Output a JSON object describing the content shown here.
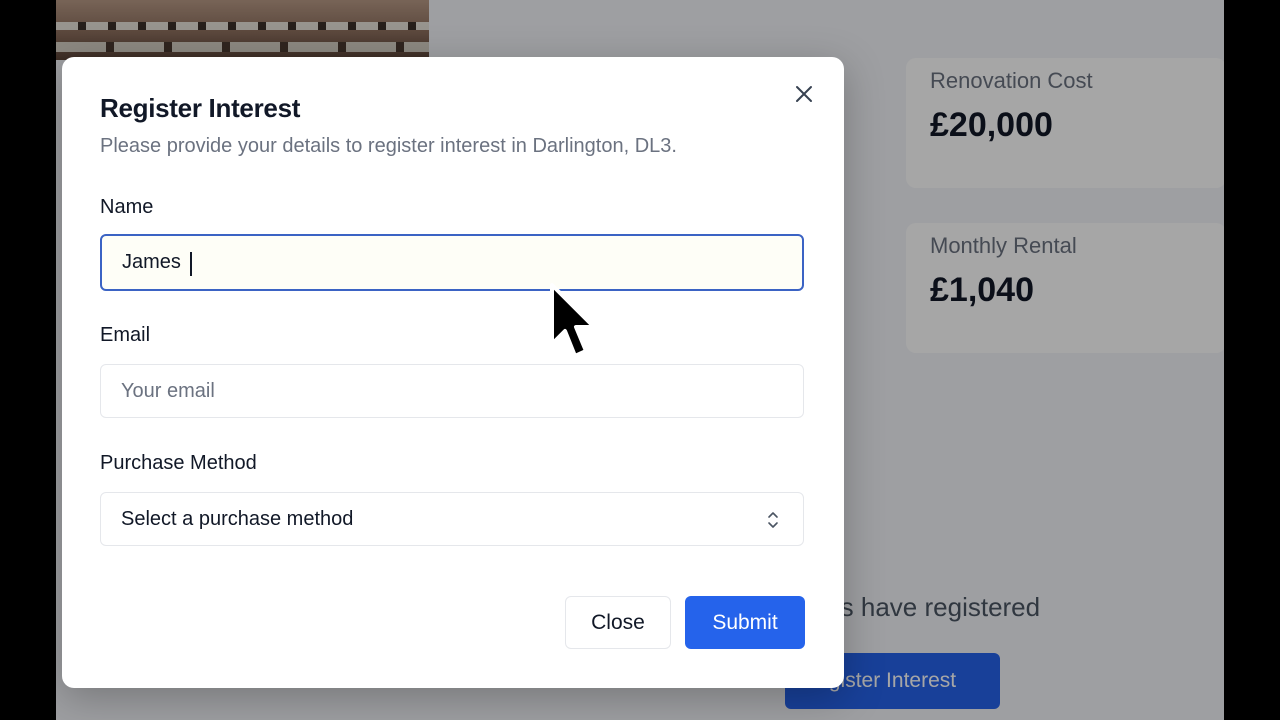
{
  "background": {
    "stats": [
      {
        "label": "Renovation Cost",
        "value": "£20,000"
      },
      {
        "label": "Monthly Rental",
        "value": "£1,040"
      }
    ],
    "registered_text": "rs have registered",
    "register_button_label": "gister Interest"
  },
  "modal": {
    "title": "Register Interest",
    "description": "Please provide your details to register interest in Darlington, DL3.",
    "fields": {
      "name": {
        "label": "Name",
        "value": "James"
      },
      "email": {
        "label": "Email",
        "value": "",
        "placeholder": "Your email"
      },
      "purchase_method": {
        "label": "Purchase Method",
        "selected": "Select a purchase method"
      }
    },
    "buttons": {
      "close": "Close",
      "submit": "Submit"
    },
    "close_icon": "close-icon"
  },
  "colors": {
    "primary": "#2563eb",
    "focus_border": "#3b63c4",
    "muted_text": "#6b7280"
  }
}
